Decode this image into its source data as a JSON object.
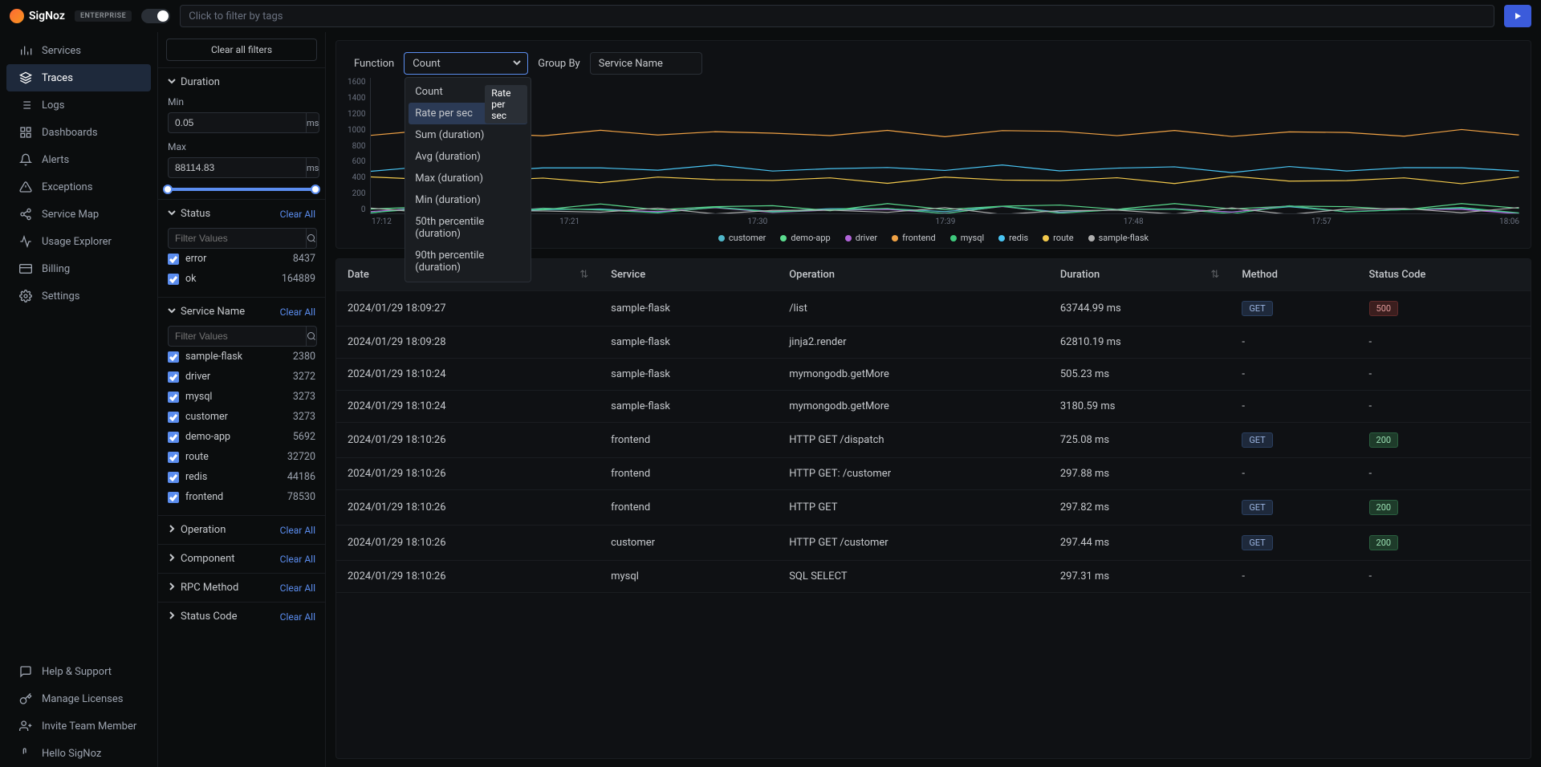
{
  "app": {
    "name": "SigNoz",
    "tier": "ENTERPRISE"
  },
  "tag_filter": {
    "placeholder": "Click to filter by tags"
  },
  "nav": {
    "items": [
      {
        "label": "Services"
      },
      {
        "label": "Traces"
      },
      {
        "label": "Logs"
      },
      {
        "label": "Dashboards"
      },
      {
        "label": "Alerts"
      },
      {
        "label": "Exceptions"
      },
      {
        "label": "Service Map"
      },
      {
        "label": "Usage Explorer"
      },
      {
        "label": "Billing"
      },
      {
        "label": "Settings"
      }
    ],
    "footer": [
      {
        "label": "Help & Support"
      },
      {
        "label": "Manage Licenses"
      },
      {
        "label": "Invite Team Member"
      },
      {
        "label": "Hello SigNoz"
      }
    ]
  },
  "filters": {
    "clear_all_label": "Clear all filters",
    "clear_link": "Clear All",
    "duration": {
      "title": "Duration",
      "min_label": "Min",
      "min_value": "0.05",
      "max_label": "Max",
      "max_value": "88114.83",
      "unit": "ms"
    },
    "status": {
      "title": "Status",
      "placeholder": "Filter Values",
      "items": [
        {
          "label": "error",
          "count": "8437"
        },
        {
          "label": "ok",
          "count": "164889"
        }
      ]
    },
    "service_name": {
      "title": "Service Name",
      "placeholder": "Filter Values",
      "items": [
        {
          "label": "sample-flask",
          "count": "2380"
        },
        {
          "label": "driver",
          "count": "3272"
        },
        {
          "label": "mysql",
          "count": "3273"
        },
        {
          "label": "customer",
          "count": "3273"
        },
        {
          "label": "demo-app",
          "count": "5692"
        },
        {
          "label": "route",
          "count": "32720"
        },
        {
          "label": "redis",
          "count": "44186"
        },
        {
          "label": "frontend",
          "count": "78530"
        }
      ]
    },
    "collapsed": [
      {
        "title": "Operation"
      },
      {
        "title": "Component"
      },
      {
        "title": "RPC Method"
      },
      {
        "title": "Status Code"
      }
    ]
  },
  "controls": {
    "function_label": "Function",
    "function_value": "Count",
    "group_by_label": "Group By",
    "group_by_value": "Service Name",
    "dropdown": {
      "items": [
        "Count",
        "Rate per sec",
        "Sum (duration)",
        "Avg (duration)",
        "Max (duration)",
        "Min (duration)",
        "50th percentile (duration)",
        "90th percentile (duration)"
      ]
    },
    "tooltip": "Rate per sec"
  },
  "chart_data": {
    "type": "line",
    "y_ticks": [
      "1600",
      "1400",
      "1200",
      "1000",
      "800",
      "600",
      "400",
      "200",
      "0"
    ],
    "x_ticks": [
      "17:12",
      "17:21",
      "17:30",
      "17:39",
      "17:48",
      "17:57",
      "18:06"
    ],
    "ylim": [
      0,
      1600
    ],
    "series": [
      {
        "name": "customer",
        "color": "#4fb6c9",
        "approx_level": 40
      },
      {
        "name": "demo-app",
        "color": "#5bdc8f",
        "approx_level": 70
      },
      {
        "name": "driver",
        "color": "#b064d8",
        "approx_level": 40
      },
      {
        "name": "frontend",
        "color": "#f0a245",
        "approx_level": 950
      },
      {
        "name": "mysql",
        "color": "#3fc97d",
        "approx_level": 40
      },
      {
        "name": "redis",
        "color": "#49c4f2",
        "approx_level": 530
      },
      {
        "name": "route",
        "color": "#f2c94c",
        "approx_level": 400
      },
      {
        "name": "sample-flask",
        "color": "#b0b0b0",
        "approx_level": 30
      }
    ]
  },
  "table": {
    "headers": {
      "date": "Date",
      "service": "Service",
      "operation": "Operation",
      "duration": "Duration",
      "method": "Method",
      "status_code": "Status Code"
    },
    "rows": [
      {
        "date": "2024/01/29 18:09:27",
        "service": "sample-flask",
        "operation": "/list",
        "duration": "63744.99 ms",
        "method": "GET",
        "status": "500"
      },
      {
        "date": "2024/01/29 18:09:28",
        "service": "sample-flask",
        "operation": "jinja2.render",
        "duration": "62810.19 ms",
        "method": "-",
        "status": "-"
      },
      {
        "date": "2024/01/29 18:10:24",
        "service": "sample-flask",
        "operation": "mymongodb.getMore",
        "duration": "505.23 ms",
        "method": "-",
        "status": "-"
      },
      {
        "date": "2024/01/29 18:10:24",
        "service": "sample-flask",
        "operation": "mymongodb.getMore",
        "duration": "3180.59 ms",
        "method": "-",
        "status": "-"
      },
      {
        "date": "2024/01/29 18:10:26",
        "service": "frontend",
        "operation": "HTTP GET /dispatch",
        "duration": "725.08 ms",
        "method": "GET",
        "status": "200"
      },
      {
        "date": "2024/01/29 18:10:26",
        "service": "frontend",
        "operation": "HTTP GET: /customer",
        "duration": "297.88 ms",
        "method": "-",
        "status": "-"
      },
      {
        "date": "2024/01/29 18:10:26",
        "service": "frontend",
        "operation": "HTTP GET",
        "duration": "297.82 ms",
        "method": "GET",
        "status": "200"
      },
      {
        "date": "2024/01/29 18:10:26",
        "service": "customer",
        "operation": "HTTP GET /customer",
        "duration": "297.44 ms",
        "method": "GET",
        "status": "200"
      },
      {
        "date": "2024/01/29 18:10:26",
        "service": "mysql",
        "operation": "SQL SELECT",
        "duration": "297.31 ms",
        "method": "-",
        "status": "-"
      }
    ]
  }
}
